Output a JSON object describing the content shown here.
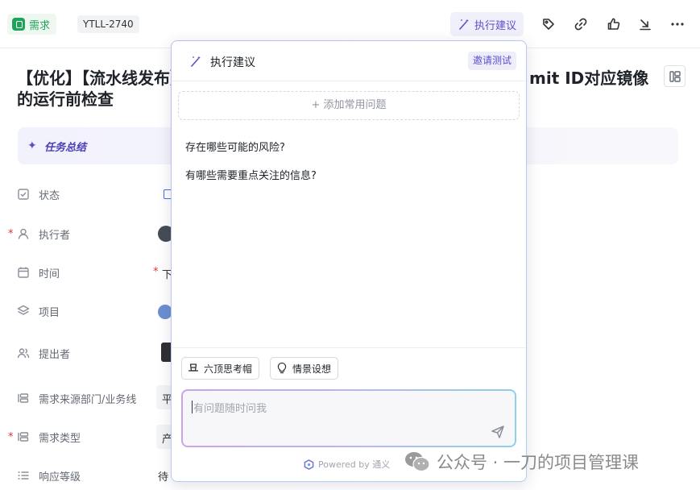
{
  "header": {
    "type_label": "需求",
    "issue_id": "YTLL-2740",
    "exec_button": "执行建议"
  },
  "title": {
    "line1_start": "【优化】【流水线发布】",
    "line1_end": "mit ID对应镜像",
    "line2": "的运行前检查"
  },
  "summary": {
    "label": "任务总结"
  },
  "fields": [
    {
      "label": "状态",
      "required": false
    },
    {
      "label": "执行者",
      "required": true
    },
    {
      "label": "时间",
      "required": false
    },
    {
      "label": "项目",
      "required": false
    },
    {
      "label": "提出者",
      "required": false
    },
    {
      "label": "需求来源部门/业务线",
      "required": false
    },
    {
      "label": "需求类型",
      "required": true
    },
    {
      "label": "响应等级",
      "required": false
    }
  ],
  "field_values": {
    "time": "下",
    "source_dept": "平",
    "req_type": "产",
    "response": "待"
  },
  "popup": {
    "title": "执行建议",
    "invite": "邀请测试",
    "add_question": "+ 添加常用问题",
    "questions": [
      "存在哪些可能的风险?",
      "有哪些需要重点关注的信息?"
    ],
    "tools": [
      "六顶思考帽",
      "情景设想"
    ],
    "input_placeholder": "有问题随时问我",
    "powered_by": "Powered by 通义"
  },
  "watermark": "公众号 · 一刀的项目管理课",
  "colors": {
    "accent": "#5b4fc8",
    "green": "#1fa35a",
    "required": "#e0342e"
  }
}
